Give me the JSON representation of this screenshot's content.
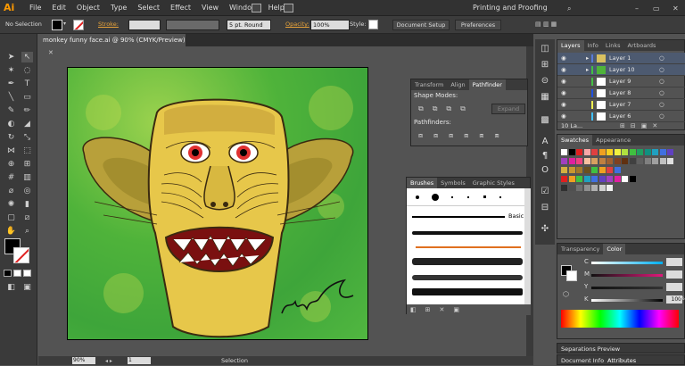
{
  "menubar": {
    "logo": "Ai",
    "menus": [
      "File",
      "Edit",
      "Object",
      "Type",
      "Select",
      "Effect",
      "View",
      "Window",
      "Help"
    ],
    "workspace": "Printing and Proofing"
  },
  "control": {
    "selection": "No Selection",
    "stroke_label": "Stroke:",
    "stroke_profile": "5 pt. Round",
    "opacity_label": "Opacity:",
    "opacity_value": "100%",
    "style_label": "Style:",
    "doc_setup": "Document Setup",
    "preferences": "Preferences"
  },
  "document": {
    "tab_title": "monkey funny face.ai @ 90% (CMYK/Preview)",
    "zoom": "90%",
    "page": "1",
    "status": "Selection"
  },
  "pathfinder": {
    "tabs": [
      "Transform",
      "Align",
      "Pathfinder"
    ],
    "shape_modes": "Shape Modes:",
    "pathfinders": "Pathfinders:",
    "expand": "Expand"
  },
  "brushes": {
    "tabs": [
      "Brushes",
      "Symbols",
      "Graphic Styles"
    ],
    "basic": "Basic"
  },
  "layers": {
    "tabs": [
      "Layers",
      "Info",
      "Links",
      "Artboards"
    ],
    "items": [
      {
        "name": "Layer 1",
        "color": "#5a7bd8"
      },
      {
        "name": "Layer 10",
        "color": "#43c043"
      },
      {
        "name": "Layer 9",
        "color": "#43c043"
      },
      {
        "name": "Layer 8",
        "color": "#2050e0"
      },
      {
        "name": "Layer 7",
        "color": "#f0f050"
      },
      {
        "name": "Layer 6",
        "color": "#40c0ff"
      }
    ],
    "count": "10 La..."
  },
  "swatches": {
    "tabs": [
      "Swatches",
      "Appearance"
    ]
  },
  "color": {
    "tabs": [
      "Transparency",
      "Color"
    ],
    "channels": [
      {
        "label": "C",
        "value": ""
      },
      {
        "label": "M",
        "value": ""
      },
      {
        "label": "Y",
        "value": ""
      },
      {
        "label": "K",
        "value": "100"
      }
    ],
    "cmyk_note": "%"
  },
  "separations": {
    "title": "Separations Preview"
  },
  "bottom_tabs": [
    "Document Info",
    "Attributes"
  ]
}
